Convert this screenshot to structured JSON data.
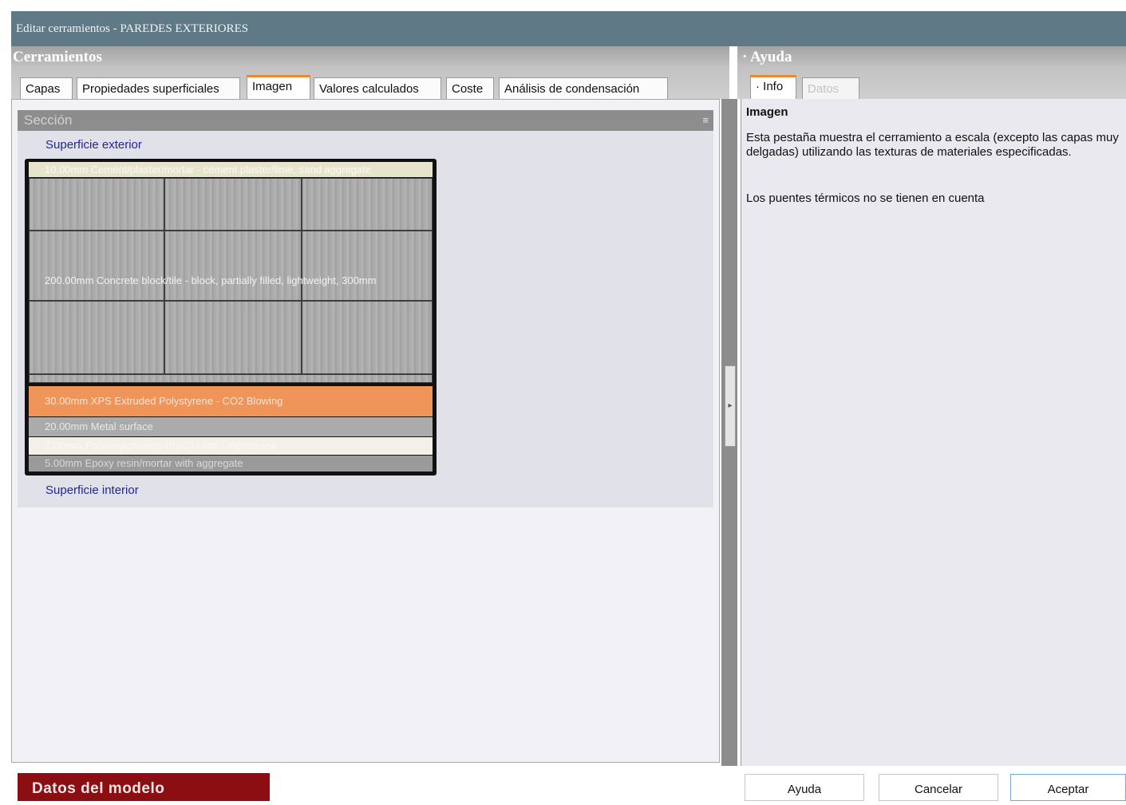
{
  "window": {
    "title": "Editar cerramientos - PAREDES EXTERIORES"
  },
  "left": {
    "heading": "Cerramientos",
    "tabs": [
      {
        "label": "Capas"
      },
      {
        "label": "Propiedades superficiales"
      },
      {
        "label": "Imagen"
      },
      {
        "label": "Valores calculados"
      },
      {
        "label": "Coste"
      },
      {
        "label": "Análisis de condensación"
      }
    ],
    "section_title": "Sección",
    "collapse_glyph": "≡",
    "outer_surface": "Superficie exterior",
    "inner_surface": "Superficie interior",
    "layers": [
      {
        "label": "10.00mm   Cement/plaster/mortar - cement plaster/lime, sand aggregate"
      },
      {
        "label": "200.00mm Concrete block/tile - block, partially filled, lightweight, 300mm"
      },
      {
        "label": "30.00mm   XPS Extruded Polystyrene - CO2 Blowing"
      },
      {
        "label": "20.00mm   Metal surface"
      },
      {
        "label": "2.00mm    Polyvinylchloride (PVC) - film / membrane"
      },
      {
        "label": "5.00mm      Epoxy resin/mortar with aggregate"
      }
    ],
    "colors": {
      "accent": "#e88a32",
      "insulation": "#f0955a"
    }
  },
  "right": {
    "heading": "Ayuda",
    "tabs": [
      {
        "label": "Info"
      },
      {
        "label": "Datos"
      }
    ],
    "help_title": "Imagen",
    "help_p1": "Esta pestaña muestra el cerramiento a escala (excepto las capas muy delgadas) utilizando las texturas de materiales especificadas.",
    "help_p2": "Los puentes térmicos no se tienen en cuenta"
  },
  "footer": {
    "model_data": "Datos del modelo",
    "help_btn": "Ayuda",
    "cancel_btn": "Cancelar",
    "accept_btn": "Aceptar"
  },
  "icons": {
    "splitter": "collapse-arrow-icon",
    "section": "collapse-icon"
  }
}
